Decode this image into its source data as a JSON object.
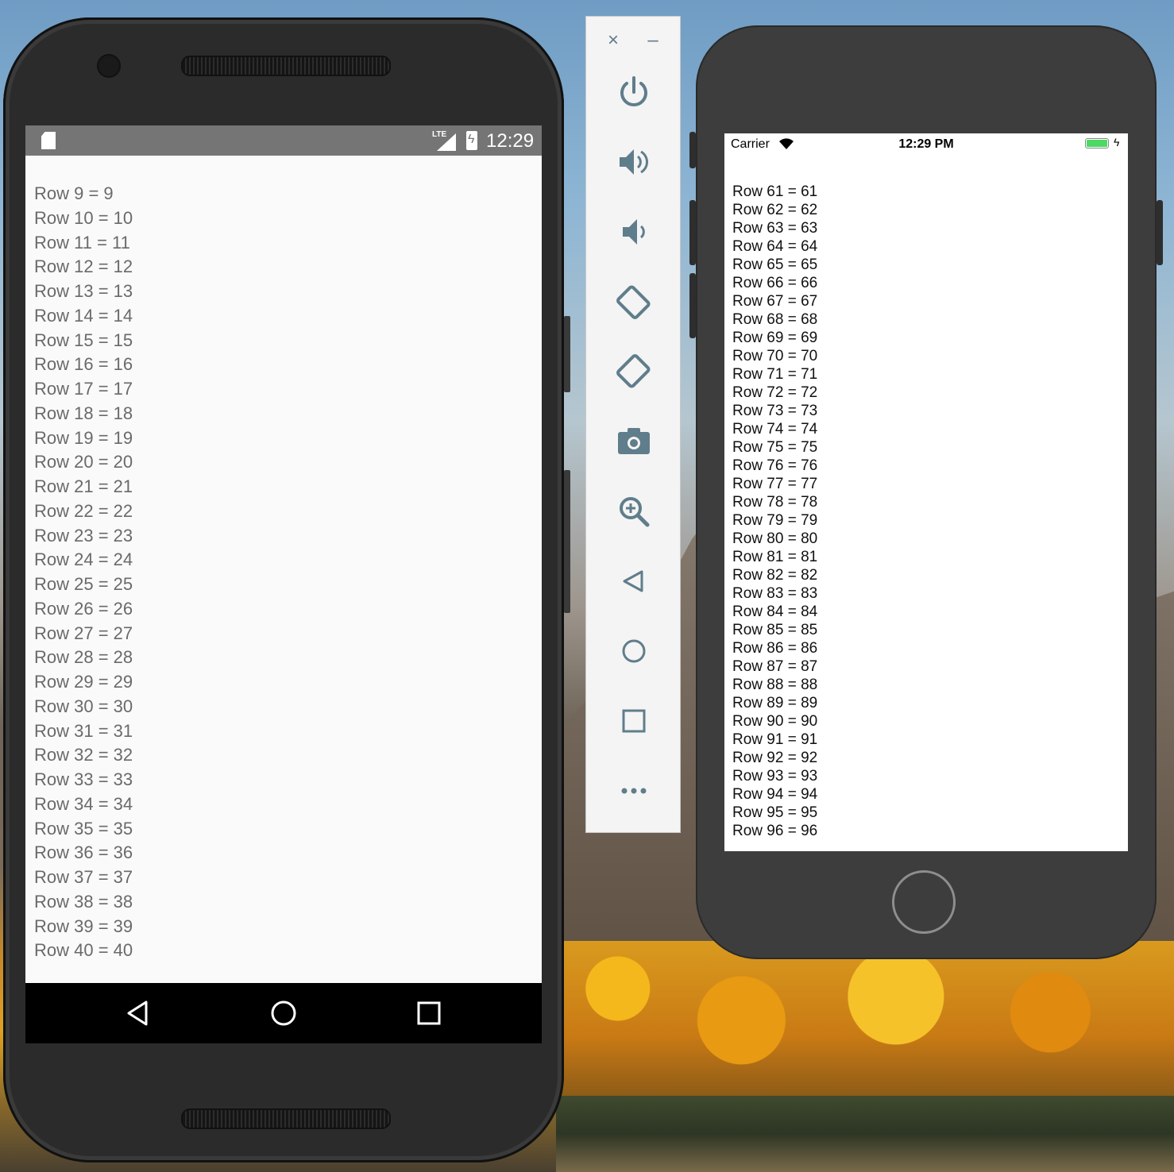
{
  "android": {
    "status_time": "12:29",
    "status_network": "LTE",
    "rows": [
      "Row 9 = 9",
      "Row 10 = 10",
      "Row 11 = 11",
      "Row 12 = 12",
      "Row 13 = 13",
      "Row 14 = 14",
      "Row 15 = 15",
      "Row 16 = 16",
      "Row 17 = 17",
      "Row 18 = 18",
      "Row 19 = 19",
      "Row 20 = 20",
      "Row 21 = 21",
      "Row 22 = 22",
      "Row 23 = 23",
      "Row 24 = 24",
      "Row 25 = 25",
      "Row 26 = 26",
      "Row 27 = 27",
      "Row 28 = 28",
      "Row 29 = 29",
      "Row 30 = 30",
      "Row 31 = 31",
      "Row 32 = 32",
      "Row 33 = 33",
      "Row 34 = 34",
      "Row 35 = 35",
      "Row 36 = 36",
      "Row 37 = 37",
      "Row 38 = 38",
      "Row 39 = 39",
      "Row 40 = 40"
    ],
    "nav_icons": [
      "back-icon",
      "home-icon",
      "overview-icon"
    ]
  },
  "toolbar": {
    "top_icons": [
      "close-icon",
      "minimize-icon"
    ],
    "tools": [
      "power-icon",
      "volume-up-icon",
      "volume-down-icon",
      "rotate-left-icon",
      "rotate-right-icon",
      "camera-icon",
      "zoom-icon",
      "back-icon",
      "home-icon",
      "overview-icon",
      "more-icon"
    ],
    "icon_color": "#607d8b"
  },
  "iphone": {
    "carrier": "Carrier",
    "status_time": "12:29 PM",
    "battery_color": "#4cd964",
    "rows": [
      "Row 61 = 61",
      "Row 62 = 62",
      "Row 63 = 63",
      "Row 64 = 64",
      "Row 65 = 65",
      "Row 66 = 66",
      "Row 67 = 67",
      "Row 68 = 68",
      "Row 69 = 69",
      "Row 70 = 70",
      "Row 71 = 71",
      "Row 72 = 72",
      "Row 73 = 73",
      "Row 74 = 74",
      "Row 75 = 75",
      "Row 76 = 76",
      "Row 77 = 77",
      "Row 78 = 78",
      "Row 79 = 79",
      "Row 80 = 80",
      "Row 81 = 81",
      "Row 82 = 82",
      "Row 83 = 83",
      "Row 84 = 84",
      "Row 85 = 85",
      "Row 86 = 86",
      "Row 87 = 87",
      "Row 88 = 88",
      "Row 89 = 89",
      "Row 90 = 90",
      "Row 91 = 91",
      "Row 92 = 92",
      "Row 93 = 93",
      "Row 94 = 94",
      "Row 95 = 95",
      "Row 96 = 96"
    ]
  }
}
